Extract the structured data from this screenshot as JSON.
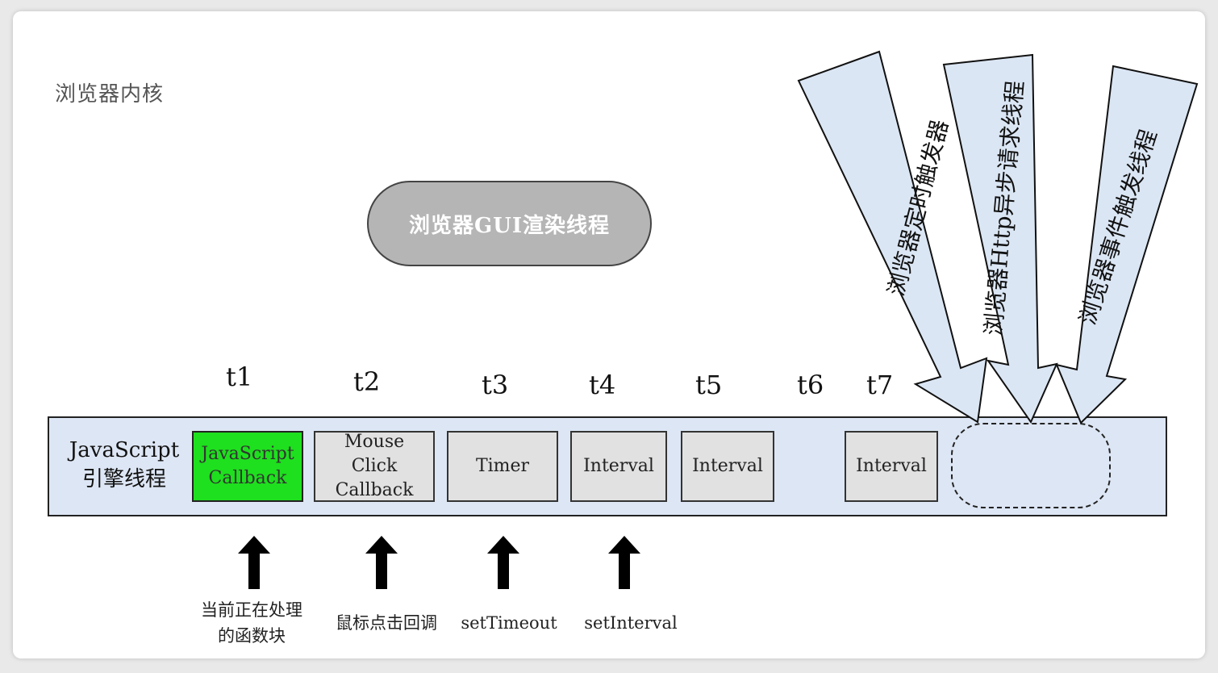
{
  "title": "浏览器内核",
  "gui_thread": "浏览器GUI渲染线程",
  "js_engine": {
    "line1": "JavaScript",
    "line2": "引擎线程"
  },
  "time_labels": [
    "t1",
    "t2",
    "t3",
    "t4",
    "t5",
    "t6",
    "t7"
  ],
  "tasks": [
    {
      "lines": [
        "JavaScript",
        "Callback"
      ],
      "state": "current"
    },
    {
      "lines": [
        "Mouse",
        "Click",
        "Callback"
      ],
      "state": "queued"
    },
    {
      "lines": [
        "Timer"
      ],
      "state": "queued"
    },
    {
      "lines": [
        "Interval"
      ],
      "state": "queued"
    },
    {
      "lines": [
        "Interval"
      ],
      "state": "queued"
    },
    {
      "lines": [
        "Interval"
      ],
      "state": "queued"
    }
  ],
  "sources": [
    {
      "lines": [
        "当前正在处理",
        "的函数块"
      ]
    },
    {
      "lines": [
        "鼠标点击回调"
      ]
    },
    {
      "lines": [
        "setTimeout"
      ]
    },
    {
      "lines": [
        "setInterval"
      ]
    }
  ],
  "trigger_threads": [
    "浏览器定时触发器",
    "浏览器Http异步请求线程",
    "浏览器事件触发线程"
  ],
  "colors": {
    "current_task": "#1ee01e",
    "queued_task": "#e1e1e1",
    "engine_band": "#dde6f4",
    "gui_pill": "#b5b5b5",
    "trigger_arrow": "#dbe6f4"
  }
}
